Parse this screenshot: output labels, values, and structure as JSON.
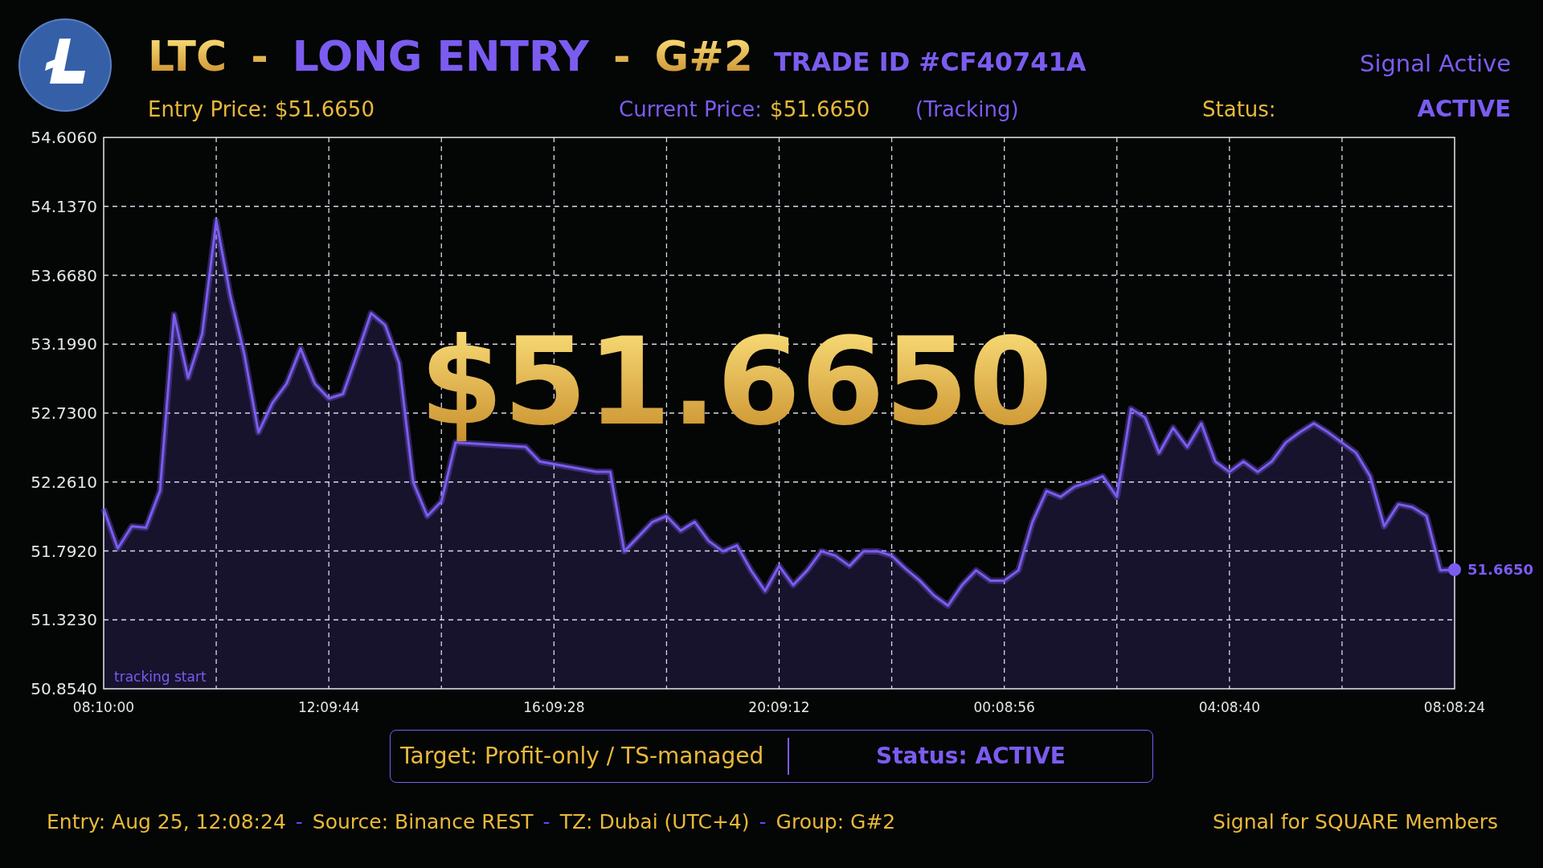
{
  "header": {
    "title_parts": [
      {
        "text": "LTC",
        "kind": "gold"
      },
      {
        "text": "-",
        "kind": "gold"
      },
      {
        "text": "LONG ENTRY",
        "kind": "accent"
      },
      {
        "text": "-",
        "kind": "gold"
      },
      {
        "text": "G#2",
        "kind": "gold"
      }
    ],
    "trade_id": "TRADE ID #CF40741A",
    "signal_state": "Signal Active",
    "entry_price": "Entry Price: $51.6650",
    "current_price_label": "Current Price:",
    "current_price": "$51.6650",
    "tracking": "(Tracking)",
    "status_label": "Status:",
    "status_value": "ACTIVE"
  },
  "chart": {
    "big_price": "$51.6650",
    "start_label": "tracking start",
    "end_label": "51.6650",
    "chart_data": {
      "type": "area",
      "categories": [
        "08:10:00",
        null,
        null,
        null,
        null,
        null,
        null,
        null,
        null,
        null,
        null,
        null,
        null,
        null,
        null,
        null,
        "12:09:44",
        null,
        null,
        null,
        null,
        null,
        null,
        null,
        null,
        null,
        null,
        null,
        null,
        null,
        null,
        null,
        "16:09:28",
        null,
        null,
        null,
        null,
        null,
        null,
        null,
        null,
        null,
        null,
        null,
        null,
        null,
        null,
        null,
        "20:09:12",
        null,
        null,
        null,
        null,
        null,
        null,
        null,
        null,
        null,
        null,
        null,
        null,
        null,
        null,
        null,
        "00:08:56",
        null,
        null,
        null,
        null,
        null,
        null,
        null,
        null,
        null,
        null,
        null,
        null,
        null,
        null,
        null,
        "04:08:40",
        null,
        null,
        null,
        null,
        null,
        null,
        null,
        null,
        null,
        null,
        null,
        null,
        null,
        null,
        null,
        "08:08:24"
      ],
      "series": [
        {
          "color": "#7b5cf0",
          "values": [
            52.08,
            51.81,
            51.96,
            51.95,
            52.2,
            53.4,
            52.97,
            53.27,
            54.04,
            53.53,
            53.13,
            52.6,
            52.8,
            52.93,
            53.17,
            52.93,
            52.83,
            52.86,
            53.13,
            53.41,
            53.33,
            53.07,
            52.26,
            52.03,
            52.13,
            52.53,
            null,
            null,
            null,
            null,
            52.5,
            52.4,
            null,
            null,
            null,
            52.33,
            52.33,
            51.79,
            51.89,
            51.99,
            52.03,
            51.93,
            51.99,
            51.86,
            51.79,
            51.83,
            51.66,
            51.52,
            51.69,
            51.56,
            51.66,
            51.79,
            51.76,
            51.69,
            51.79,
            51.79,
            51.76,
            51.67,
            51.59,
            51.49,
            51.42,
            51.56,
            51.66,
            51.59,
            51.59,
            51.66,
            51.99,
            52.2,
            52.16,
            52.23,
            52.26,
            52.3,
            52.16,
            52.76,
            52.7,
            52.46,
            52.63,
            52.5,
            52.66,
            52.4,
            52.33,
            52.4,
            52.33,
            52.4,
            52.53,
            52.6,
            52.66,
            52.6,
            52.53,
            52.46,
            52.3,
            51.96,
            52.11,
            52.09,
            52.03,
            51.66,
            51.665
          ]
        }
      ],
      "ylim": [
        50.854,
        54.606
      ],
      "grid": true,
      "yticks": [
        {
          "value": 50.854,
          "label": "50.8540"
        },
        {
          "value": 51.323,
          "label": "51.3230"
        },
        {
          "value": 51.792,
          "label": "51.7920"
        },
        {
          "value": 52.261,
          "label": "52.2610"
        },
        {
          "value": 52.73,
          "label": "52.7300"
        },
        {
          "value": 53.199,
          "label": "53.1990"
        },
        {
          "value": 53.668,
          "label": "53.6680"
        },
        {
          "value": 54.137,
          "label": "54.1370"
        },
        {
          "value": 54.606,
          "label": "54.6060"
        }
      ]
    }
  },
  "status_box": {
    "target": "Target: Profit-only / TS-managed",
    "status": "Status: ACTIVE"
  },
  "footer": {
    "items": [
      {
        "text": "Entry: Aug 25, 12:08:24",
        "kind": "info"
      },
      {
        "text": "-",
        "kind": "separator"
      },
      {
        "text": "Source: Binance REST",
        "kind": "info"
      },
      {
        "text": "-",
        "kind": "separator"
      },
      {
        "text": "TZ: Dubai (UTC+4)",
        "kind": "info"
      },
      {
        "text": "-",
        "kind": "separator"
      },
      {
        "text": "Group: G#2",
        "kind": "info"
      }
    ],
    "audience": "Signal for SQUARE Members"
  }
}
